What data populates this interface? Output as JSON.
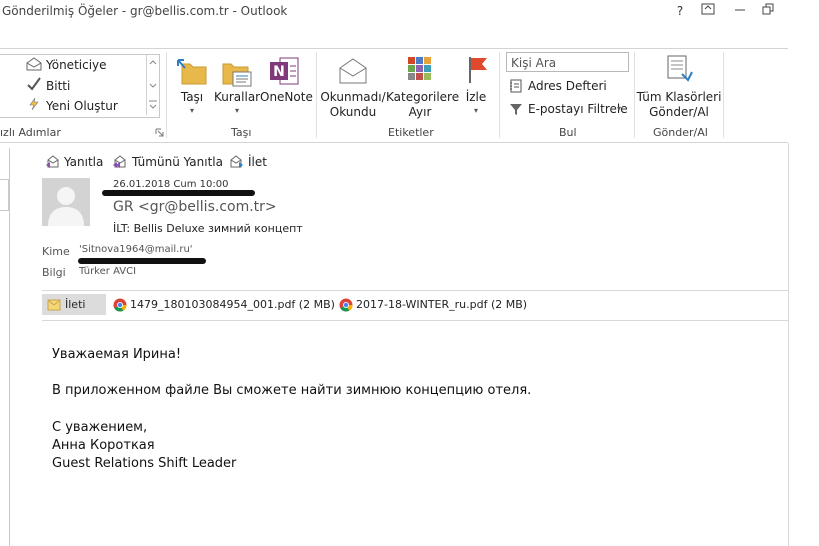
{
  "window": {
    "title": "Gönderilmiş Öğeler - gr@bellis.com.tr - Outlook",
    "help_btn": "?"
  },
  "ribbon": {
    "quick_steps": {
      "items": [
        "Yöneticiye",
        "Bitti",
        "Yeni Oluştur"
      ],
      "group_label": "ızlı Adımlar"
    },
    "move": {
      "buttons": [
        "Taşı",
        "Kurallar",
        "OneNote"
      ],
      "group_label": "Taşı"
    },
    "tags": {
      "read_unread_line1": "Okunmadı/",
      "read_unread_line2": "Okundu",
      "categorize_line1": "Kategorilere",
      "categorize_line2": "Ayır",
      "followup": "İzle",
      "group_label": "Etiketler"
    },
    "find": {
      "search_placeholder": "Kişi Ara",
      "address_book": "Adres Defteri",
      "filter_email": "E-postayı Filtrele",
      "group_label": "Bul"
    },
    "send_receive": {
      "line1": "Tüm Klasörleri",
      "line2": "Gönder/Al",
      "group_label": "Gönder/Al"
    }
  },
  "reading_pane": {
    "actions": [
      "Yanıtla",
      "Tümünü Yanıtla",
      "İlet"
    ],
    "date": "26.01.2018 Cum 10:00",
    "sender": "GR  <gr@bellis.com.tr>",
    "subject": "İLT: Bellis Deluxe зимний концепт",
    "to_label": "Kime",
    "to_value": "'Sitnova1964@mail.ru'",
    "cc_label": "Bilgi",
    "cc_value": "Türker AVCI",
    "attachments": {
      "message_tab": "İleti",
      "files": [
        "1479_180103084954_001.pdf (2 MB)",
        "2017-18-WINTER_ru.pdf (2 MB)"
      ]
    },
    "body": {
      "greeting": "Уважаемая Ирина!",
      "line1": "В приложенном файле Вы сможете найти зимнюю концепцию отеля.",
      "closing": "С уважением,",
      "name": "Анна Короткая",
      "position": "Guest Relations Shift Leader"
    }
  },
  "colors": {
    "accent_red": "#d24726",
    "onenote_purple": "#80397b",
    "folder_yellow": "#e8b84a",
    "flag_red": "#e0492b"
  }
}
